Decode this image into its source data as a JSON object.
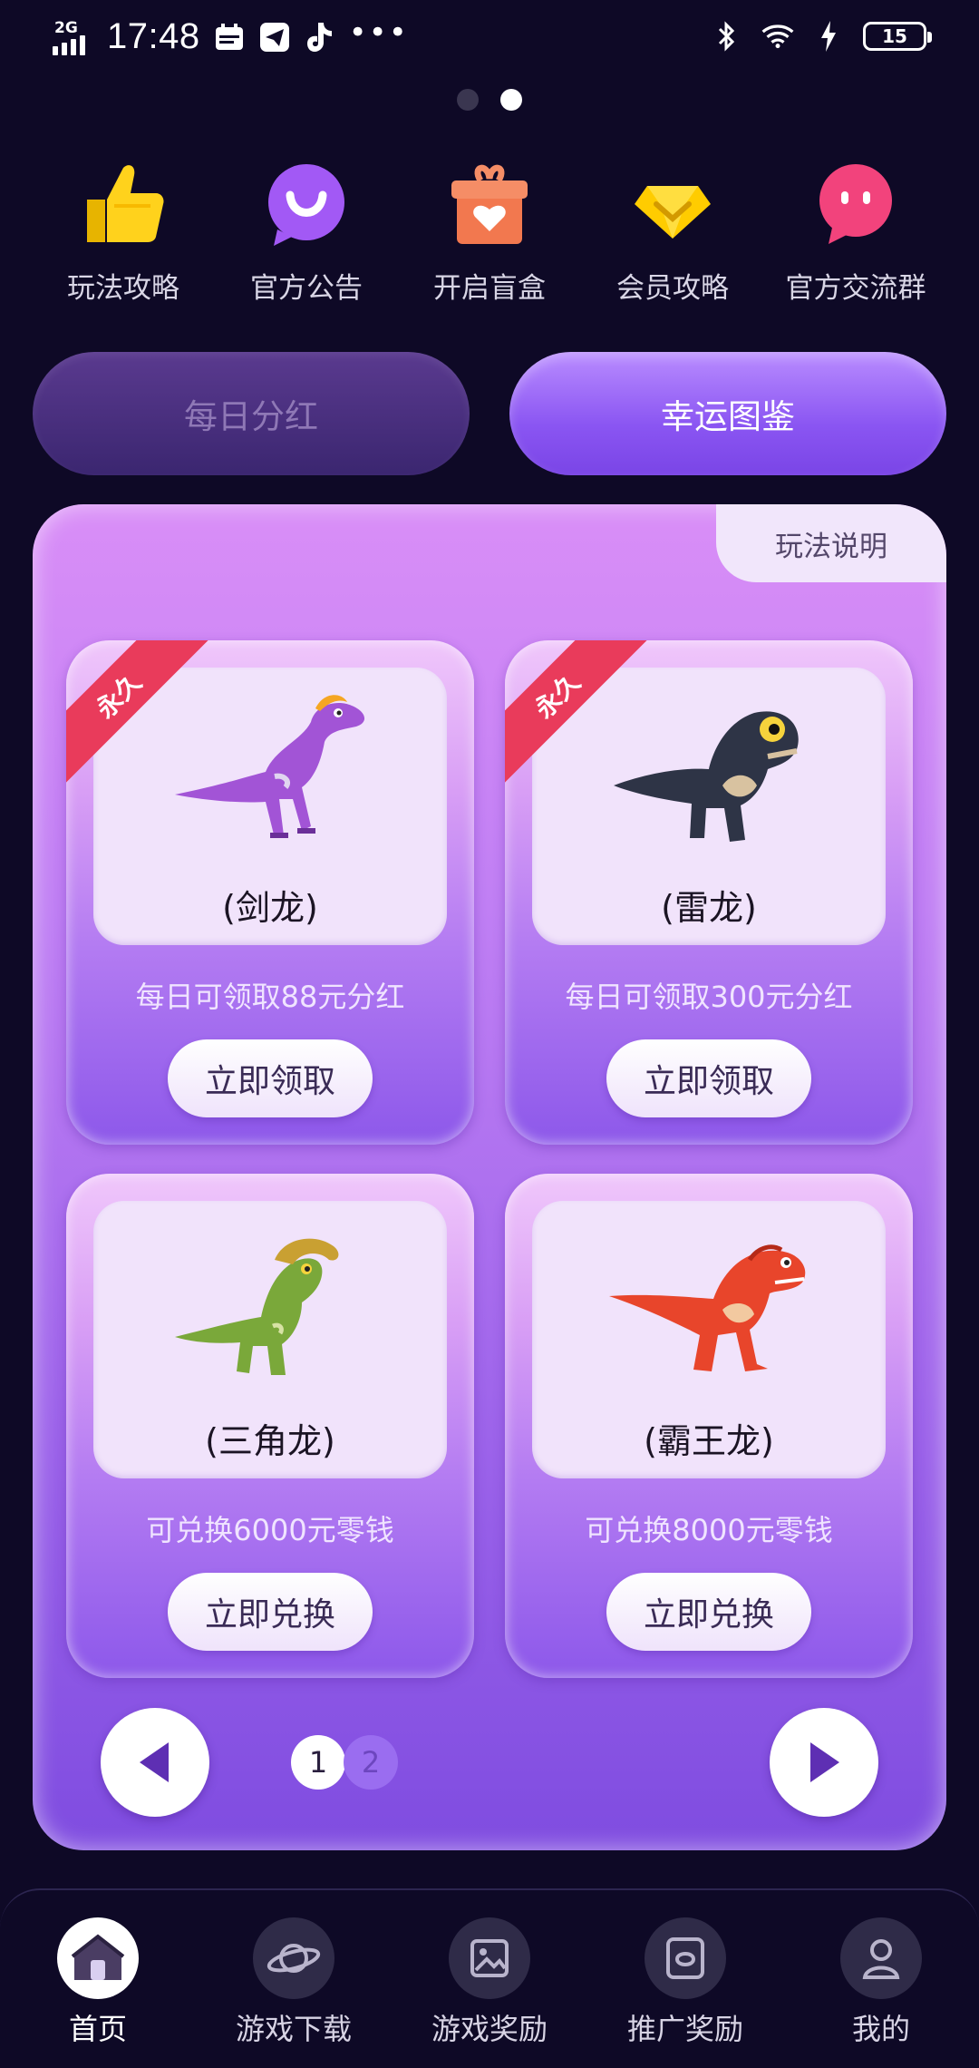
{
  "status_bar": {
    "network": "2G",
    "time": "17:48",
    "battery": "15"
  },
  "shortcuts": [
    {
      "label": "玩法攻略",
      "icon": "thumbs-up-icon"
    },
    {
      "label": "官方公告",
      "icon": "smile-bubble-icon"
    },
    {
      "label": "开启盲盒",
      "icon": "gift-box-icon"
    },
    {
      "label": "会员攻略",
      "icon": "diamond-icon"
    },
    {
      "label": "官方交流群",
      "icon": "chat-face-icon"
    }
  ],
  "segments": {
    "daily_dividend": "每日分红",
    "lucky_catalog": "幸运图鉴",
    "selected": "幸运图鉴"
  },
  "panel": {
    "help_label": "玩法说明",
    "cards": [
      {
        "ribbon": "永久",
        "name": "(剑龙)",
        "desc": "每日可领取88元分红",
        "button": "立即领取",
        "color": "#a254d6"
      },
      {
        "ribbon": "永久",
        "name": "(雷龙)",
        "desc": "每日可领取300元分红",
        "button": "立即领取",
        "color": "#2e3446"
      },
      {
        "ribbon": "",
        "name": "(三角龙)",
        "desc": "可兑换6000元零钱",
        "button": "立即兑换",
        "color": "#7aa83a"
      },
      {
        "ribbon": "",
        "name": "(霸王龙)",
        "desc": "可兑换8000元零钱",
        "button": "立即兑换",
        "color": "#e8452b"
      }
    ],
    "pager": {
      "current": "1",
      "next": "2"
    }
  },
  "bottom_nav": [
    {
      "label": "首页",
      "icon": "home-icon",
      "active": true
    },
    {
      "label": "游戏下载",
      "icon": "planet-icon",
      "active": false
    },
    {
      "label": "游戏奖励",
      "icon": "image-icon",
      "active": false
    },
    {
      "label": "推广奖励",
      "icon": "share-card-icon",
      "active": false
    },
    {
      "label": "我的",
      "icon": "user-icon",
      "active": false
    }
  ],
  "colors": {
    "background": "#0e0926",
    "accent": "#8a55f2",
    "ribbon": "#e93b5b"
  }
}
